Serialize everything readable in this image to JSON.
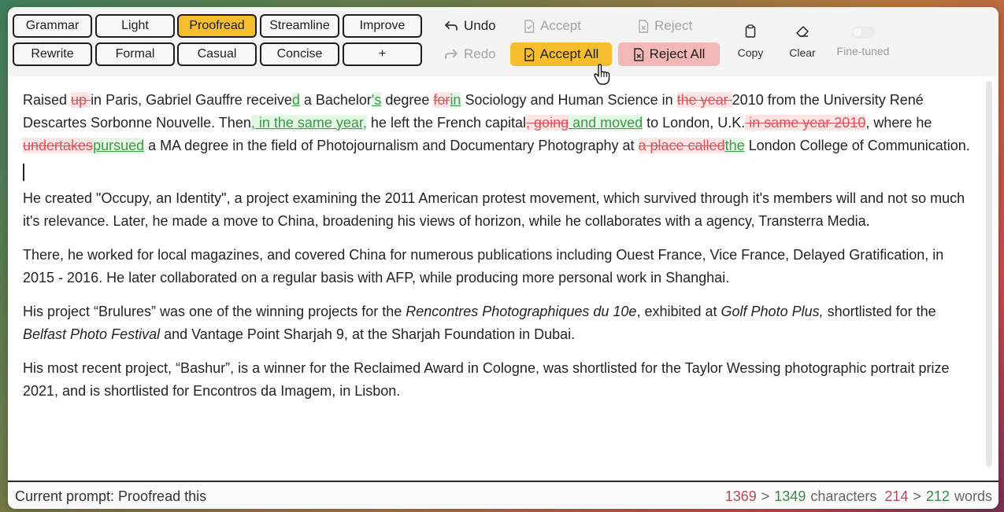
{
  "toolbar": {
    "modes_row1": [
      "Grammar",
      "Light",
      "Proofread",
      "Streamline",
      "Improve"
    ],
    "modes_row2": [
      "Rewrite",
      "Formal",
      "Casual",
      "Concise",
      "+"
    ],
    "active_mode": "Proofread",
    "undo_label": "Undo",
    "redo_label": "Redo",
    "accept_label": "Accept",
    "reject_label": "Reject",
    "accept_all_label": "Accept All",
    "reject_all_label": "Reject All",
    "copy_label": "Copy",
    "clear_label": "Clear",
    "fine_tuned_label": "Fine-tuned"
  },
  "document": {
    "p1": [
      {
        "t": "Raised "
      },
      {
        "del": "up "
      },
      {
        "t": "in Paris, Gabriel Gauffre receive"
      },
      {
        "ins": "d"
      },
      {
        "t": " a Bachelor"
      },
      {
        "ins": "'s"
      },
      {
        "t": " degree "
      },
      {
        "del": "for"
      },
      {
        "ins": "in"
      },
      {
        "t": " Sociology and Human Science in "
      },
      {
        "del": "the year "
      },
      {
        "t": "2010 from the University René Descartes Sorbonne Nouvelle. Then"
      },
      {
        "ins": ", in the same year,"
      },
      {
        "t": " he left the French capital"
      },
      {
        "del": ", going"
      },
      {
        "ins": " and moved"
      },
      {
        "t": " to London, U.K."
      },
      {
        "del": " in same year 2010"
      },
      {
        "t": ", where he "
      },
      {
        "del": "undertakes"
      },
      {
        "ins": "pursued"
      },
      {
        "t": " a MA degree in the field of Photojournalism and Documentary Photography at "
      },
      {
        "del": "a place called"
      },
      {
        "ins": "the"
      },
      {
        "t": " London College of Communication."
      }
    ],
    "p2": "He created \"Occupy, an Identity\", a project examining the 2011 American protest movement, which survived through it's members will and not so much it's relevance. Later, he made a move to China, broadening his views of horizon, while he collaborates with a agency, Transterra Media.",
    "p3": "There, he worked for local magazines, and covered China for numerous publications including Ouest France, Vice France, Delayed Gratification, in 2015 - 2016. He later collaborated on a regular basis with AFP, while producing more personal work in Shanghai.",
    "p4": [
      {
        "t": "His project “Brulures” was one of the winning projects for the "
      },
      {
        "i": "Rencontres Photographiques du 10e"
      },
      {
        "t": ", exhibited at "
      },
      {
        "i": "Golf Photo Plus,"
      },
      {
        "t": " shortlisted for the "
      },
      {
        "i": "Belfast Photo Festival"
      },
      {
        "t": " and Vantage Point Sharjah 9, at the Sharjah Foundation in Dubai."
      }
    ],
    "p5": "His most recent project, “Bashur”, is a winner for the Reclaimed Award in Cologne, was shortlisted for the Taylor Wessing photographic portrait prize 2021, and is shortlisted for Encontros da Imagem, in Lisbon."
  },
  "status": {
    "prompt": "Current prompt: Proofread this",
    "chars_before": "1369",
    "chars_arrow": ">",
    "chars_after": "1349",
    "chars_label": "characters",
    "words_before": "214",
    "words_arrow": ">",
    "words_after": "212",
    "words_label": "words"
  },
  "colors": {
    "accent_yellow": "#f6be2d",
    "reject_pink": "#f3b8b6",
    "insert_green": "#3d9a48",
    "delete_red": "#e0525a"
  },
  "icons": [
    "undo-icon",
    "redo-icon",
    "accept-doc-icon",
    "reject-doc-icon",
    "copy-icon",
    "eraser-icon",
    "pointer-hand-icon"
  ]
}
